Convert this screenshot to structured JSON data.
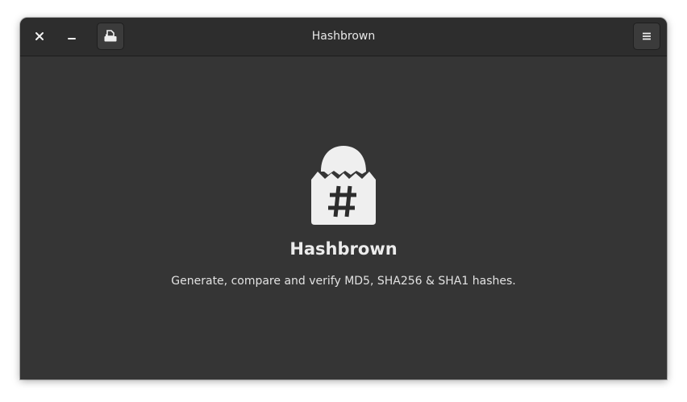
{
  "window": {
    "title": "Hashbrown"
  },
  "headerbar": {
    "close_icon": "close-icon",
    "minimize_icon": "minimize-icon",
    "open_file_icon": "document-open-icon",
    "menu_icon": "hamburger-menu-icon"
  },
  "welcome": {
    "app_name": "Hashbrown",
    "description": "Generate, compare and verify MD5, SHA256 & SHA1 hashes.",
    "icon": "hashbrown-app-icon"
  },
  "colors": {
    "window_bg": "#353535",
    "headerbar_bg": "#2d2d2d",
    "text": "#ececec",
    "icon_fill": "#efefef"
  }
}
